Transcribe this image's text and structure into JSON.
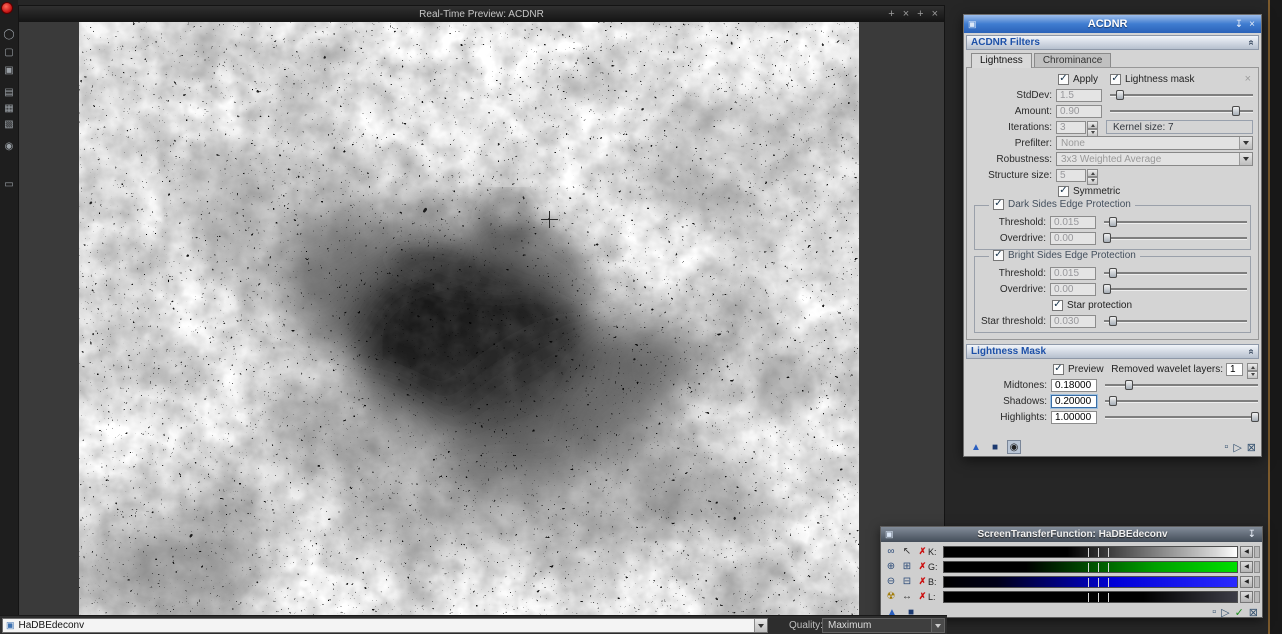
{
  "colors": {
    "accent_blue": "#2a62b8",
    "section_text": "#1c50a8",
    "stf_green": "#00e000",
    "stf_blue": "#2a2aff",
    "record_red": "#c31414"
  },
  "icons": {
    "win": "▣",
    "pin": "↧",
    "close": "×",
    "collapse": "«",
    "check": "✓",
    "dim_close": "×",
    "view": "▣",
    "red_x": "✗",
    "mini_left": "◀",
    "new_instance": "▲",
    "apply_instance": "■",
    "realtime": "◉",
    "footer_square": "▫",
    "footer_play": "▷",
    "footer_cancel": "⊠",
    "footer_check": "✓",
    "chain": "∞",
    "zoom_in": "⊕",
    "zoom_out": "⊖",
    "radiation": "☢",
    "pointer": "↖",
    "grid_plus": "⊞",
    "grid_minus": "⊟",
    "resize_h": "↔"
  },
  "rail": {
    "icons": [
      "◯",
      "▢",
      "▣",
      "▤",
      "▦",
      "▧",
      "◉",
      "▭"
    ]
  },
  "preview": {
    "title": "Real-Time Preview: ACDNR",
    "buttons": [
      "+",
      "×",
      "+",
      "×"
    ]
  },
  "statusbar": {
    "view": "HaDBEdeconv",
    "quality_label": "Quality:",
    "quality_value": "Maximum"
  },
  "acdnr": {
    "title": "ACDNR",
    "filters_header": "ACDNR Filters",
    "mask_header": "Lightness Mask",
    "tabs": [
      "Lightness",
      "Chrominance"
    ],
    "apply": "Apply",
    "lightness_mask": "Lightness mask",
    "stddev_label": "StdDev:",
    "stddev": "1.5",
    "amount_label": "Amount:",
    "amount": "0.90",
    "iterations_label": "Iterations:",
    "iterations": "3",
    "kernel": "Kernel size: 7",
    "prefilter_label": "Prefilter:",
    "prefilter": "None",
    "robustness_label": "Robustness:",
    "robustness": "3x3 Weighted Average",
    "structure_label": "Structure size:",
    "structure": "5",
    "symmetric": "Symmetric",
    "dark_group": "Dark Sides Edge Protection",
    "bright_group": "Bright Sides Edge Protection",
    "threshold_label": "Threshold:",
    "overdrive_label": "Overdrive:",
    "dark_threshold": "0.015",
    "dark_overdrive": "0.00",
    "bright_threshold": "0.015",
    "bright_overdrive": "0.00",
    "star_protection": "Star protection",
    "star_threshold_label": "Star threshold:",
    "star_threshold": "0.030",
    "preview_check": "Preview",
    "wavelet_label": "Removed wavelet layers:",
    "wavelet": "1",
    "midtones_label": "Midtones:",
    "midtones": "0.18000",
    "shadows_label": "Shadows:",
    "shadows": "0.20000",
    "highlights_label": "Highlights:",
    "highlights": "1.00000"
  },
  "stf": {
    "title": "ScreenTransferFunction: HaDBEdeconv",
    "channels": [
      {
        "label": "K:"
      },
      {
        "label": "G:"
      },
      {
        "label": "B:"
      },
      {
        "label": "L:"
      }
    ]
  }
}
